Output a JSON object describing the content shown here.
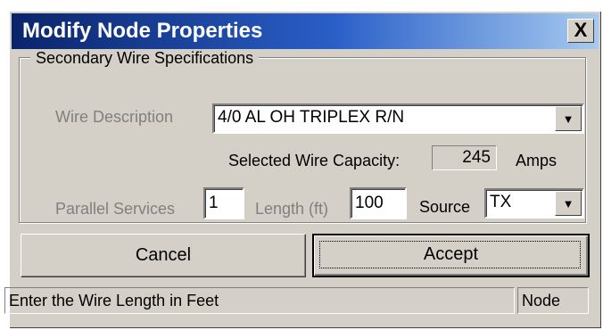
{
  "window": {
    "title": "Modify Node Properties",
    "close_label": "X"
  },
  "group": {
    "title": "Secondary Wire Specifications",
    "wire_description_label": "Wire Description",
    "wire_description_value": "4/0 AL OH TRIPLEX R/N",
    "capacity_label": "Selected Wire Capacity:",
    "capacity_value": "245",
    "capacity_unit": "Amps",
    "parallel_label": "Parallel Services",
    "parallel_value": "1",
    "length_label": "Length (ft)",
    "length_value": "100",
    "source_label": "Source",
    "source_value": "TX"
  },
  "buttons": {
    "cancel": "Cancel",
    "accept": "Accept"
  },
  "status": {
    "message": "Enter the Wire Length in Feet",
    "mode": "Node"
  }
}
